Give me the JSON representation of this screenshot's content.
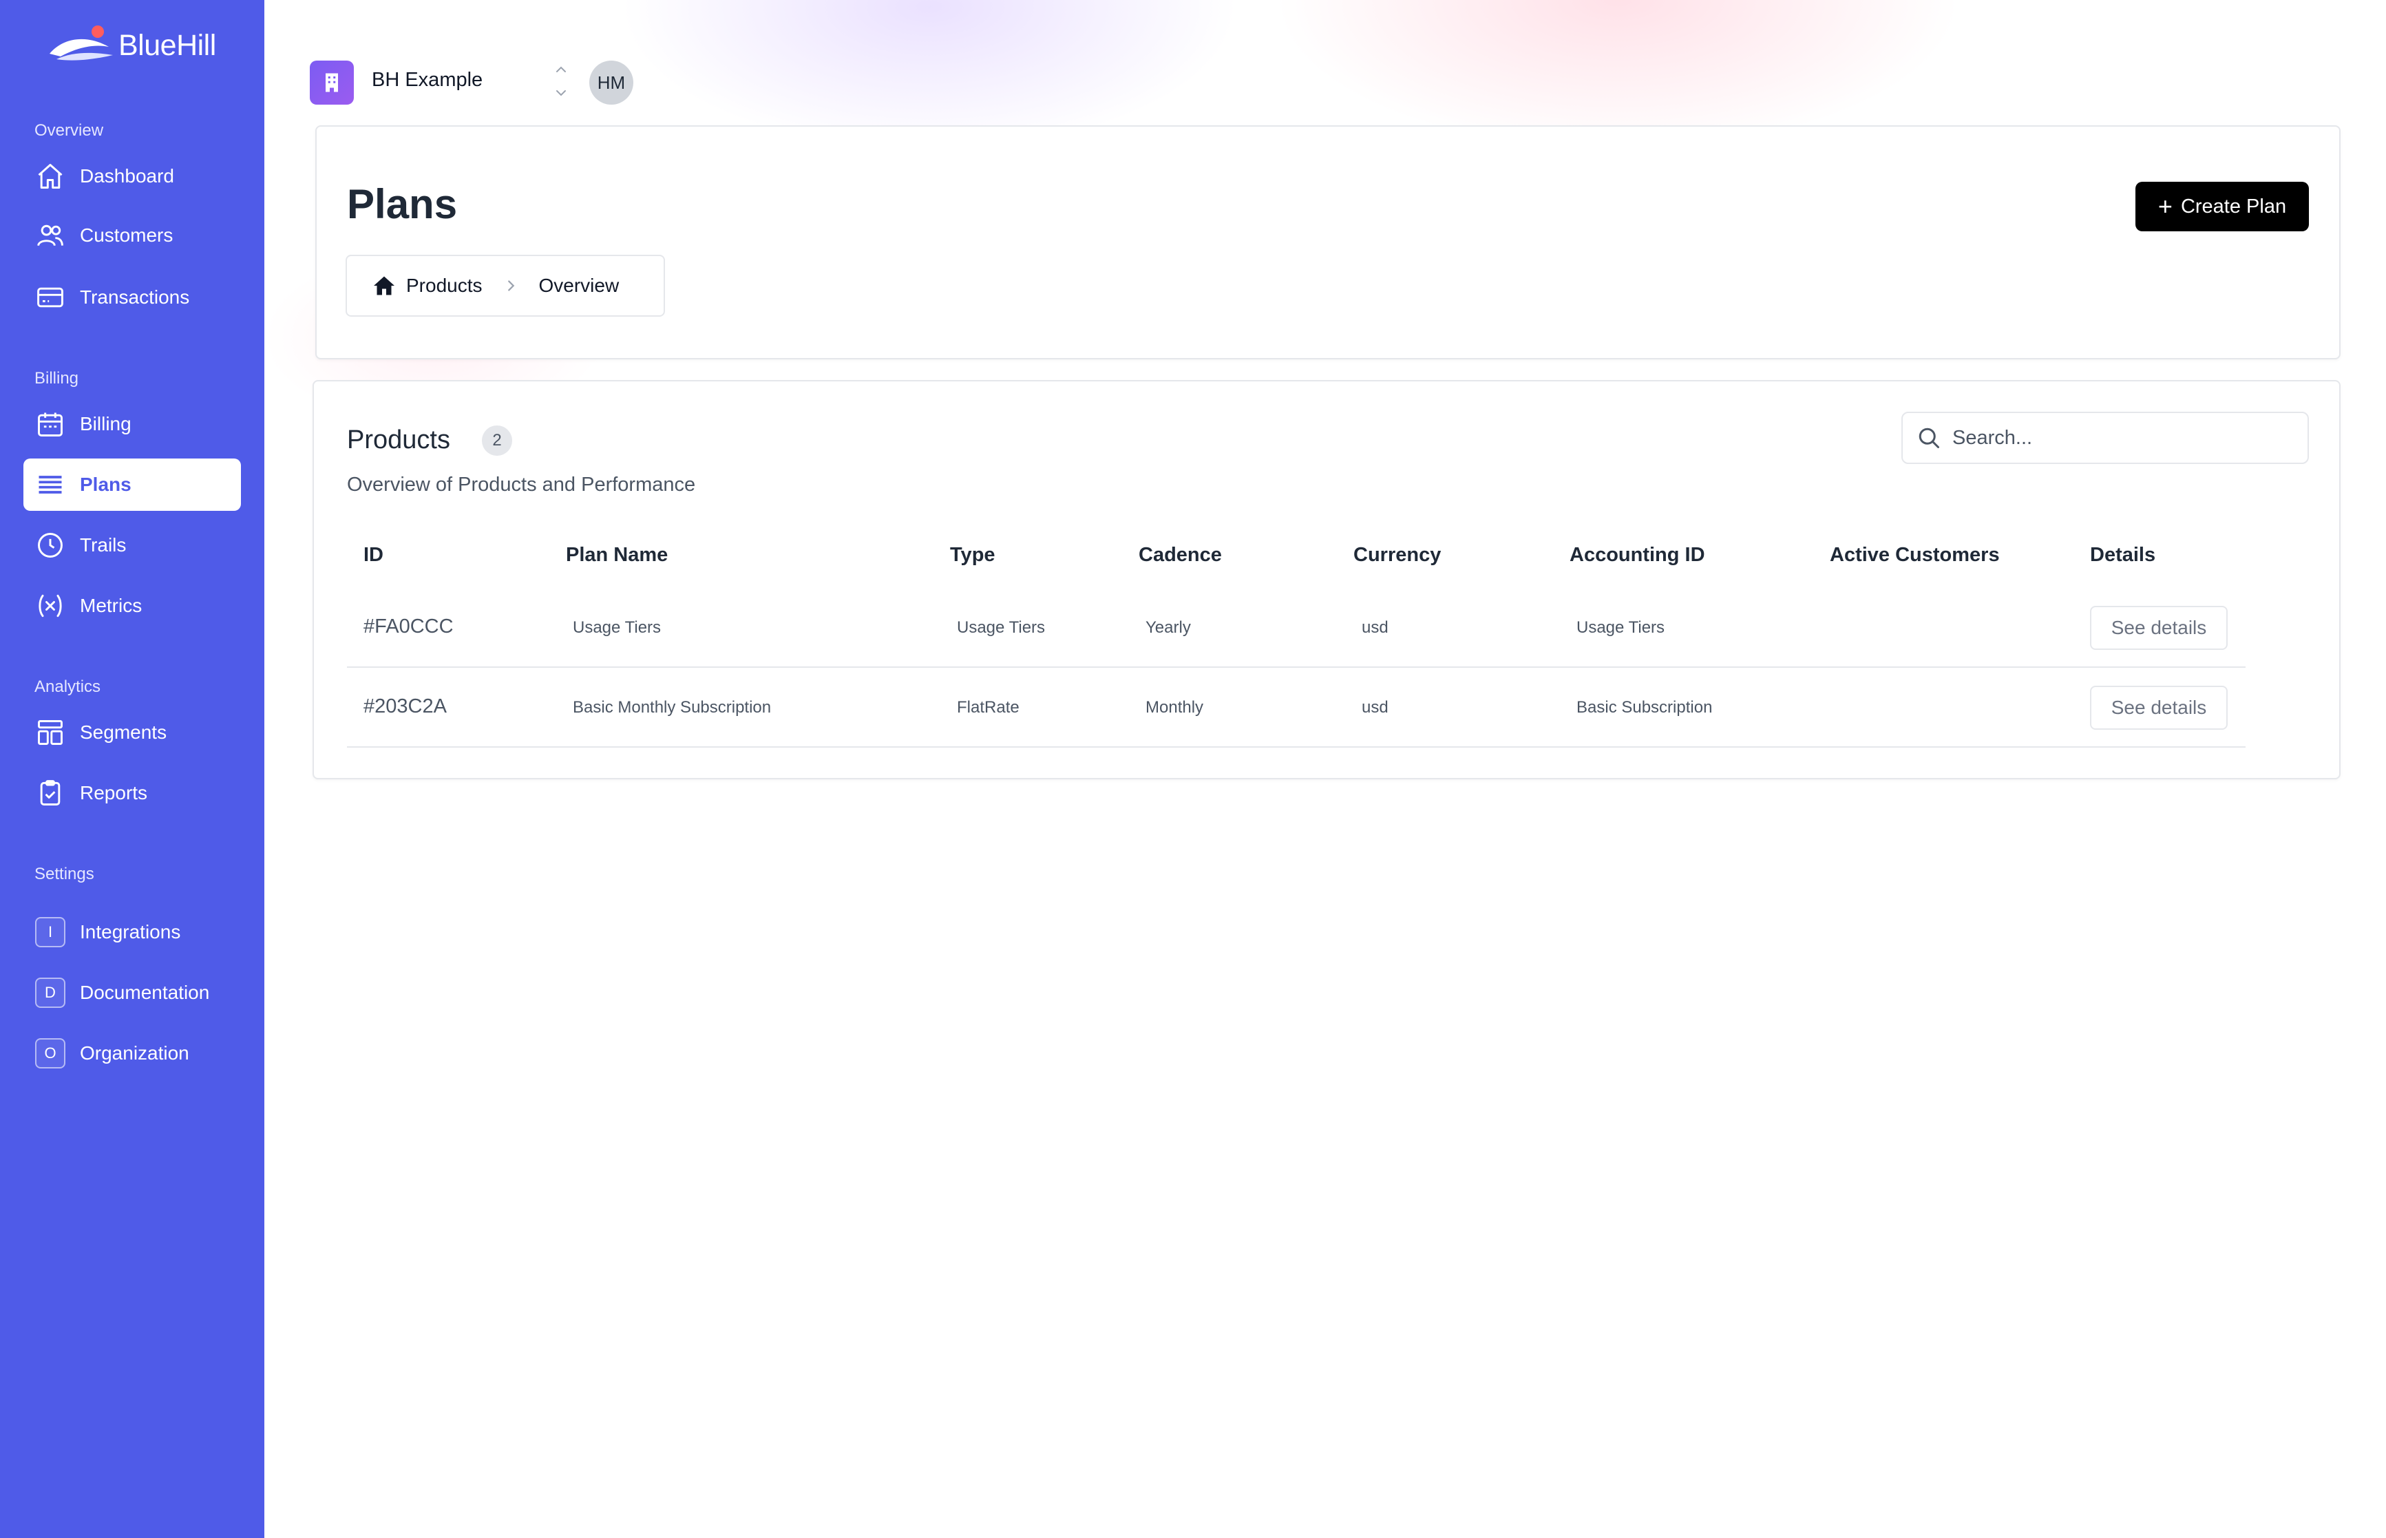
{
  "brand": {
    "name": "BlueHill"
  },
  "sidebar": {
    "sections": [
      {
        "label": "Overview"
      },
      {
        "label": "Billing"
      },
      {
        "label": "Analytics"
      },
      {
        "label": "Settings"
      }
    ],
    "items": [
      {
        "label": "Dashboard",
        "icon": "home-icon"
      },
      {
        "label": "Customers",
        "icon": "users-icon"
      },
      {
        "label": "Transactions",
        "icon": "credit-card-icon"
      },
      {
        "label": "Billing",
        "icon": "calendar-icon"
      },
      {
        "label": "Plans",
        "icon": "list-icon",
        "active": true
      },
      {
        "label": "Trails",
        "icon": "clock-icon"
      },
      {
        "label": "Metrics",
        "icon": "variable-icon"
      },
      {
        "label": "Segments",
        "icon": "layout-icon"
      },
      {
        "label": "Reports",
        "icon": "clipboard-check-icon"
      },
      {
        "label": "Integrations",
        "badge": "I"
      },
      {
        "label": "Documentation",
        "badge": "D"
      },
      {
        "label": "Organization",
        "badge": "O"
      }
    ]
  },
  "topbar": {
    "org_name": "BH Example",
    "avatar_initials": "HM"
  },
  "header": {
    "title": "Plans",
    "breadcrumb": [
      "Products",
      "Overview"
    ],
    "create_button": {
      "plus": "+",
      "label": "Create Plan"
    }
  },
  "products": {
    "title": "Products",
    "count": "2",
    "subtitle": "Overview of Products and Performance",
    "search_placeholder": "Search...",
    "columns": [
      "ID",
      "Plan Name",
      "Type",
      "Cadence",
      "Currency",
      "Accounting ID",
      "Active Customers",
      "Details"
    ],
    "rows": [
      {
        "id": "#FA0CCC",
        "plan_name": "Usage Tiers",
        "type": "Usage Tiers",
        "cadence": "Yearly",
        "currency": "usd",
        "accounting_id": "Usage Tiers",
        "active_customers": "",
        "details": "See details"
      },
      {
        "id": "#203C2A",
        "plan_name": "Basic Monthly Subscription",
        "type": "FlatRate",
        "cadence": "Monthly",
        "currency": "usd",
        "accounting_id": "Basic Subscription",
        "active_customers": "",
        "details": "See details"
      }
    ]
  },
  "colors": {
    "sidebar_bg": "#4f5be8",
    "primary_button": "#000000",
    "org_icon": "#7c5cf2"
  }
}
